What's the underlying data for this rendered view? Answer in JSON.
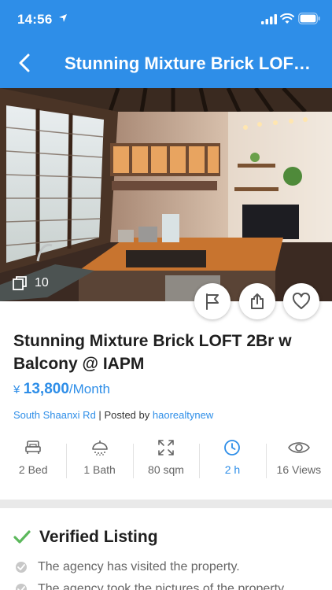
{
  "status_bar": {
    "time": "14:56"
  },
  "nav": {
    "title": "Stunning Mixture Brick LOFT 2Br w Balcony @ IAPM"
  },
  "photo": {
    "count": "10"
  },
  "listing": {
    "title": "Stunning Mixture Brick LOFT 2Br w Balcony @ IAPM",
    "currency": "¥",
    "price": "13,800",
    "price_unit": "/Month",
    "location": "South Shaanxi Rd",
    "separator": "|",
    "posted_by_label": "Posted by",
    "agent": "haorealtynew"
  },
  "stats": [
    {
      "icon": "bed-icon",
      "label": "2 Bed"
    },
    {
      "icon": "shower-icon",
      "label": "1 Bath"
    },
    {
      "icon": "expand-icon",
      "label": "80 sqm"
    },
    {
      "icon": "clock-icon",
      "label": "2 h",
      "active": true
    },
    {
      "icon": "eye-icon",
      "label": "16 Views"
    }
  ],
  "verified": {
    "title": "Verified Listing",
    "items": [
      "The agency has visited the property.",
      "The agency took the pictures of the property."
    ]
  },
  "colors": {
    "accent": "#2e8ee8",
    "check": "#5cb85c"
  }
}
